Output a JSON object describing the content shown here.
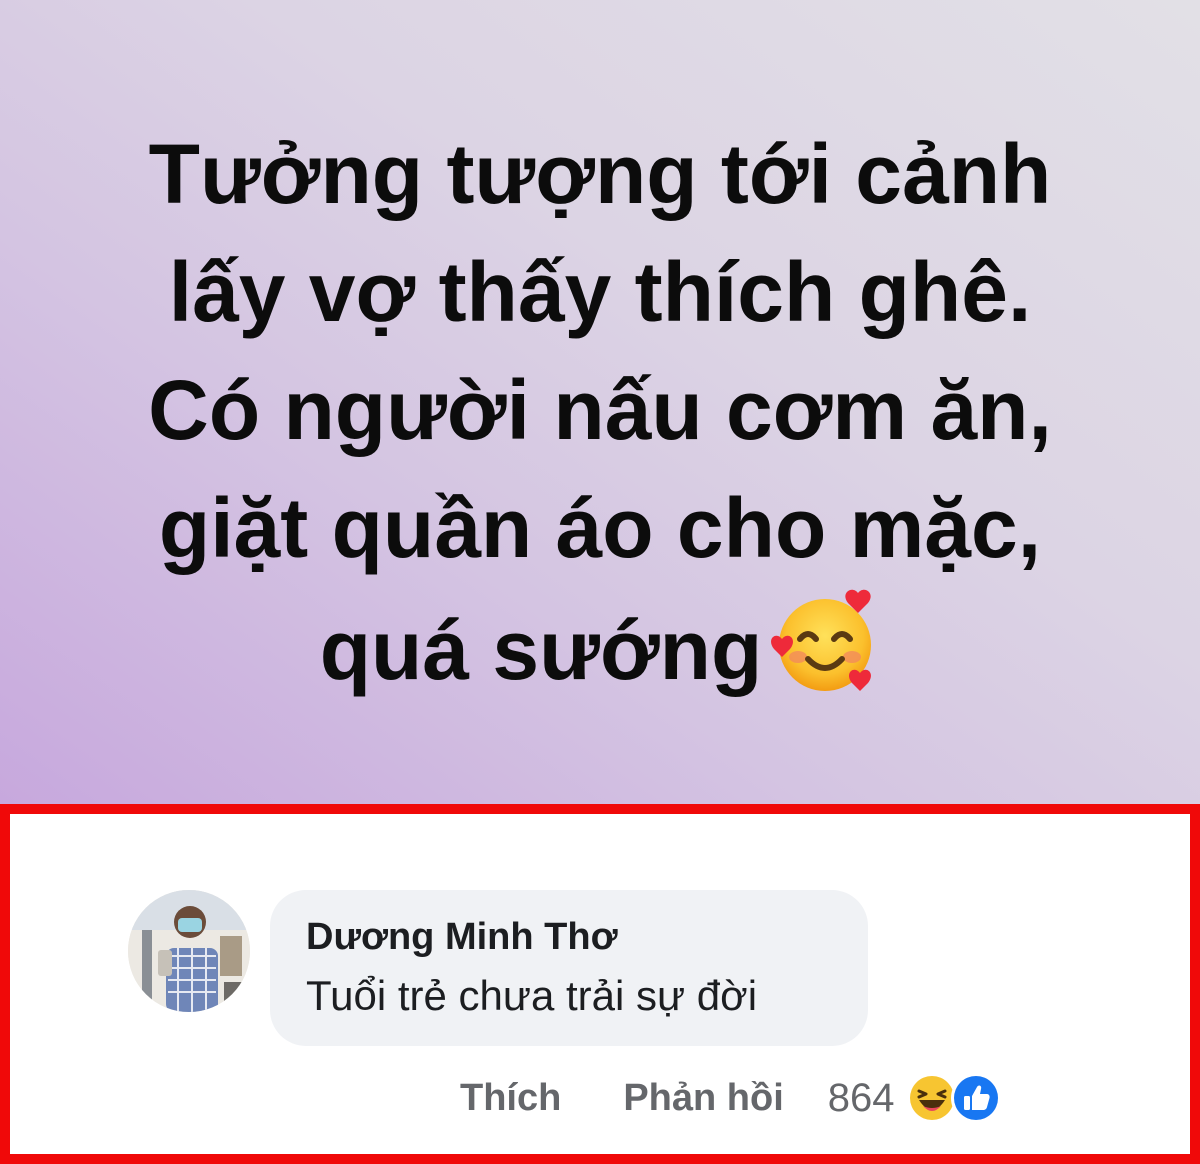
{
  "post": {
    "lines": [
      "Tưởng tượng tới cảnh",
      "lấy vợ thấy thích ghê.",
      "Có người nấu cơm ăn,",
      "giặt quần áo cho mặc,",
      "quá sướng"
    ],
    "emoji": "smiling-face-with-hearts"
  },
  "comment": {
    "author": "Dương Minh Thơ",
    "text": "Tuổi trẻ chưa trải sự đời",
    "like_label": "Thích",
    "reply_label": "Phản hồi",
    "reaction_count": "864",
    "reactions": [
      "haha",
      "like"
    ]
  },
  "colors": {
    "highlight_border": "#f00909",
    "like_blue": "#1877f2",
    "haha_yellow": "#f7c531"
  }
}
